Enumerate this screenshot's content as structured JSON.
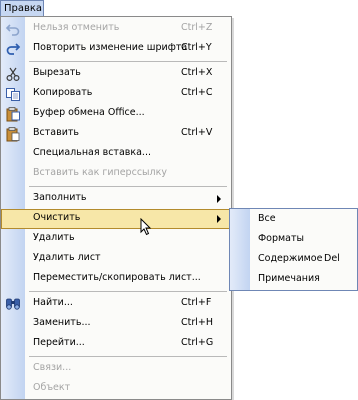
{
  "menu": {
    "title": "Правка"
  },
  "items": [
    {
      "label": "Нельзя отменить",
      "shortcut": "Ctrl+Z",
      "disabled": true,
      "icon": "undo-icon"
    },
    {
      "label": "Повторить изменение шрифта",
      "shortcut": "Ctrl+Y",
      "disabled": false,
      "icon": "redo-icon"
    },
    {
      "label": "Вырезать",
      "shortcut": "Ctrl+X",
      "disabled": false,
      "icon": "scissors-icon"
    },
    {
      "label": "Копировать",
      "shortcut": "Ctrl+C",
      "disabled": false,
      "icon": "copy-icon"
    },
    {
      "label": "Буфер обмена Office...",
      "shortcut": "",
      "disabled": false,
      "icon": "clipboard-icon"
    },
    {
      "label": "Вставить",
      "shortcut": "Ctrl+V",
      "disabled": false,
      "icon": "paste-icon"
    },
    {
      "label": "Специальная вставка...",
      "shortcut": "",
      "disabled": false,
      "icon": ""
    },
    {
      "label": "Вставить как гиперссылку",
      "shortcut": "",
      "disabled": true,
      "icon": ""
    },
    {
      "label": "Заполнить",
      "shortcut": "",
      "disabled": false,
      "icon": "",
      "submenu": true
    },
    {
      "label": "Очистить",
      "shortcut": "",
      "disabled": false,
      "icon": "",
      "submenu": true,
      "highlight": true
    },
    {
      "label": "Удалить",
      "shortcut": "",
      "disabled": false,
      "icon": ""
    },
    {
      "label": "Удалить лист",
      "shortcut": "",
      "disabled": false,
      "icon": ""
    },
    {
      "label": "Переместить/скопировать лист...",
      "shortcut": "",
      "disabled": false,
      "icon": ""
    },
    {
      "label": "Найти...",
      "shortcut": "Ctrl+F",
      "disabled": false,
      "icon": "binoculars-icon"
    },
    {
      "label": "Заменить...",
      "shortcut": "Ctrl+H",
      "disabled": false,
      "icon": ""
    },
    {
      "label": "Перейти...",
      "shortcut": "Ctrl+G",
      "disabled": false,
      "icon": ""
    },
    {
      "label": "Связи...",
      "shortcut": "",
      "disabled": true,
      "icon": ""
    },
    {
      "label": "Объект",
      "shortcut": "",
      "disabled": true,
      "icon": ""
    }
  ],
  "submenu": [
    {
      "label": "Все",
      "shortcut": ""
    },
    {
      "label": "Форматы",
      "shortcut": ""
    },
    {
      "label": "Содержимое",
      "shortcut": "Del"
    },
    {
      "label": "Примечания",
      "shortcut": ""
    }
  ],
  "colors": {
    "highlight": "#f7e7a8",
    "gutter": "#c2d4f1",
    "disabled_text": "#a4a4a4"
  }
}
